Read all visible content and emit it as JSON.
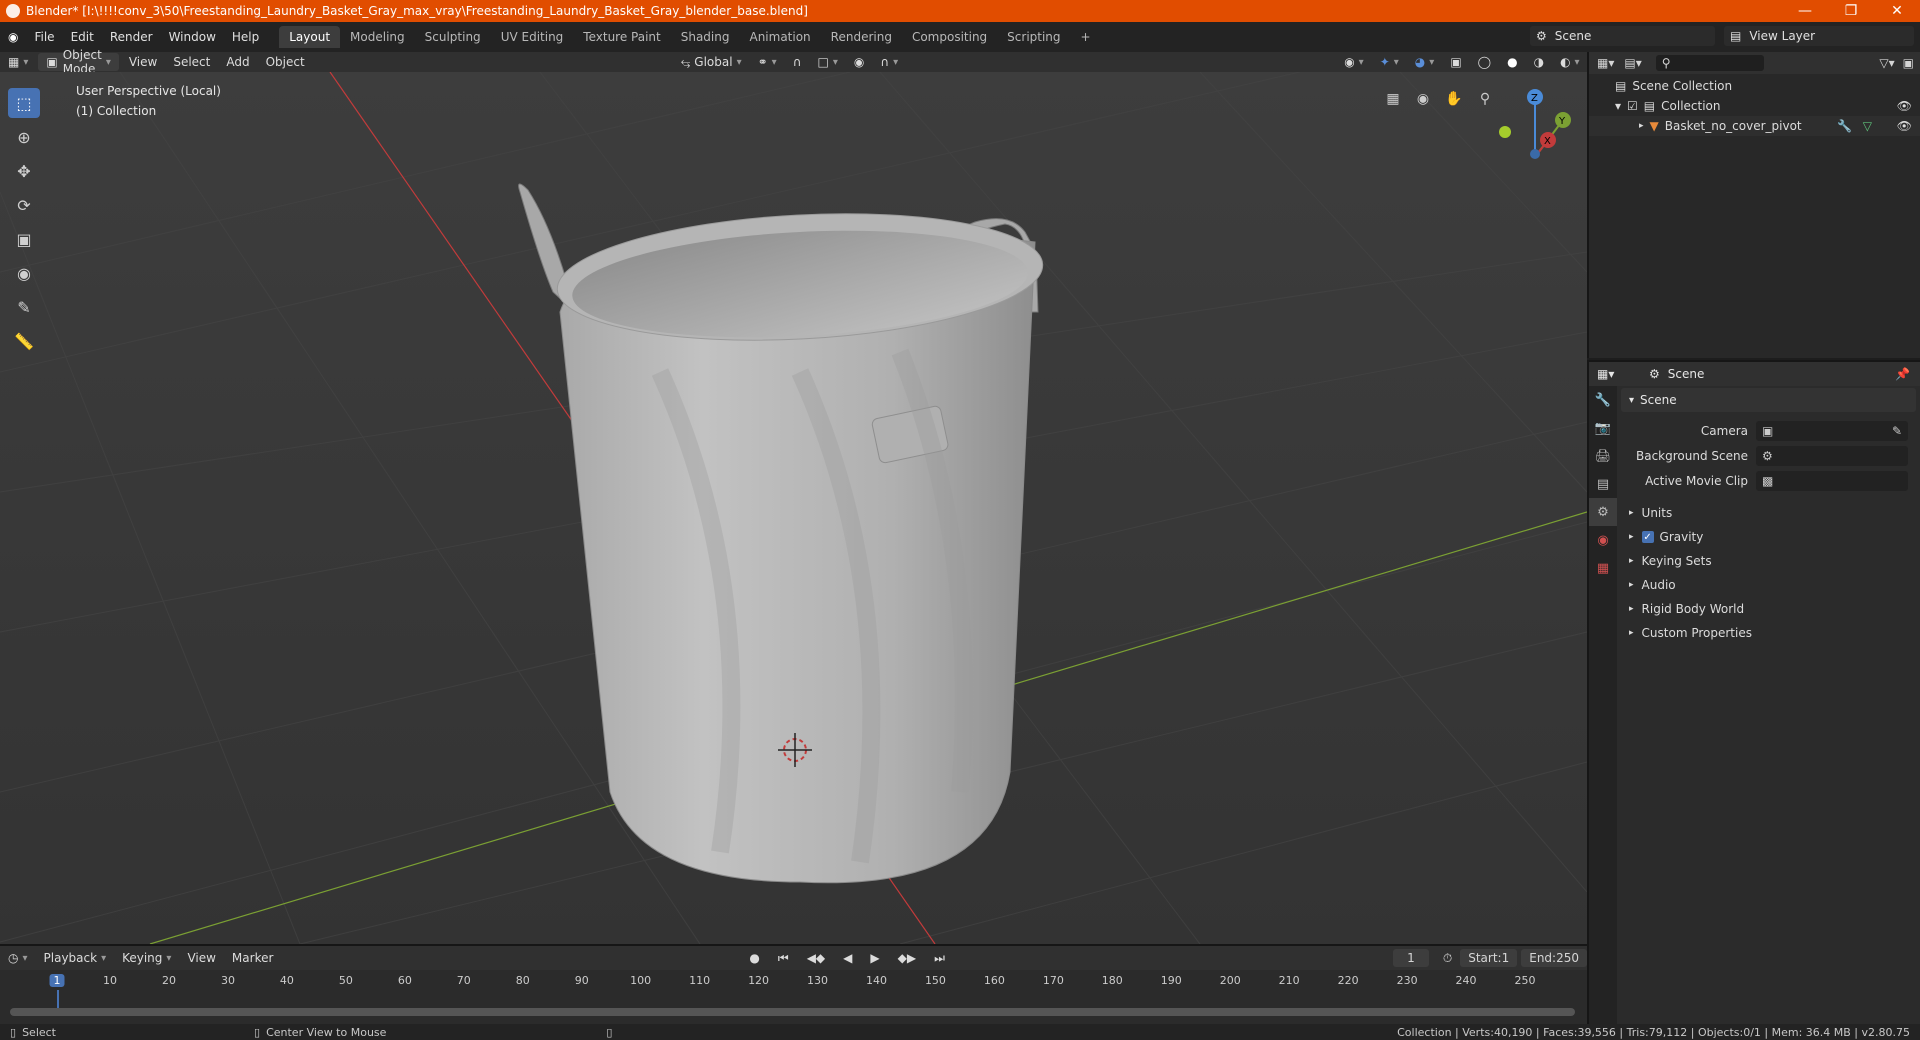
{
  "title": "Blender* [I:\\!!!!conv_3\\50\\Freestanding_Laundry_Basket_Gray_max_vray\\Freestanding_Laundry_Basket_Gray_blender_base.blend]",
  "menus": [
    "File",
    "Edit",
    "Render",
    "Window",
    "Help"
  ],
  "workspaces": [
    "Layout",
    "Modeling",
    "Sculpting",
    "UV Editing",
    "Texture Paint",
    "Shading",
    "Animation",
    "Rendering",
    "Compositing",
    "Scripting"
  ],
  "active_workspace": "Layout",
  "scene_name": "Scene",
  "view_layer": "View Layer",
  "viewport_header": {
    "mode": "Object Mode",
    "menus": [
      "View",
      "Select",
      "Add",
      "Object"
    ],
    "orientation": "Global"
  },
  "viewport": {
    "perspective": "User Perspective (Local)",
    "collection": "(1) Collection",
    "gizmo": {
      "x": "X",
      "y": "Y",
      "z": "Z"
    }
  },
  "outliner": {
    "root": "Scene Collection",
    "collection": "Collection",
    "object": "Basket_no_cover_pivot"
  },
  "properties": {
    "header": "Scene",
    "panel": "Scene",
    "fields": [
      {
        "label": "Camera",
        "value": ""
      },
      {
        "label": "Background Scene",
        "value": ""
      },
      {
        "label": "Active Movie Clip",
        "value": ""
      }
    ],
    "subpanels": [
      "Units",
      "Gravity",
      "Keying Sets",
      "Audio",
      "Rigid Body World",
      "Custom Properties"
    ],
    "gravity_checked": true
  },
  "timeline": {
    "menus": [
      "Playback",
      "Keying",
      "View",
      "Marker"
    ],
    "current_frame": "1",
    "start_label": "Start:",
    "start": "1",
    "end_label": "End:",
    "end": "250",
    "ticks": [
      "1",
      "10",
      "20",
      "30",
      "40",
      "50",
      "60",
      "70",
      "80",
      "90",
      "100",
      "110",
      "120",
      "130",
      "140",
      "150",
      "160",
      "170",
      "180",
      "190",
      "200",
      "210",
      "220",
      "230",
      "240",
      "250"
    ]
  },
  "status": {
    "left": "Select",
    "middle": "Center View to Mouse",
    "right": "Collection | Verts:40,190 | Faces:39,556 | Tris:79,112 | Objects:0/1 | Mem: 36.4 MB | v2.80.75"
  },
  "colors": {
    "title_bg": "#e14d00",
    "accent": "#4772b3",
    "x_axis": "#c23b3b",
    "y_axis": "#7ba033"
  }
}
